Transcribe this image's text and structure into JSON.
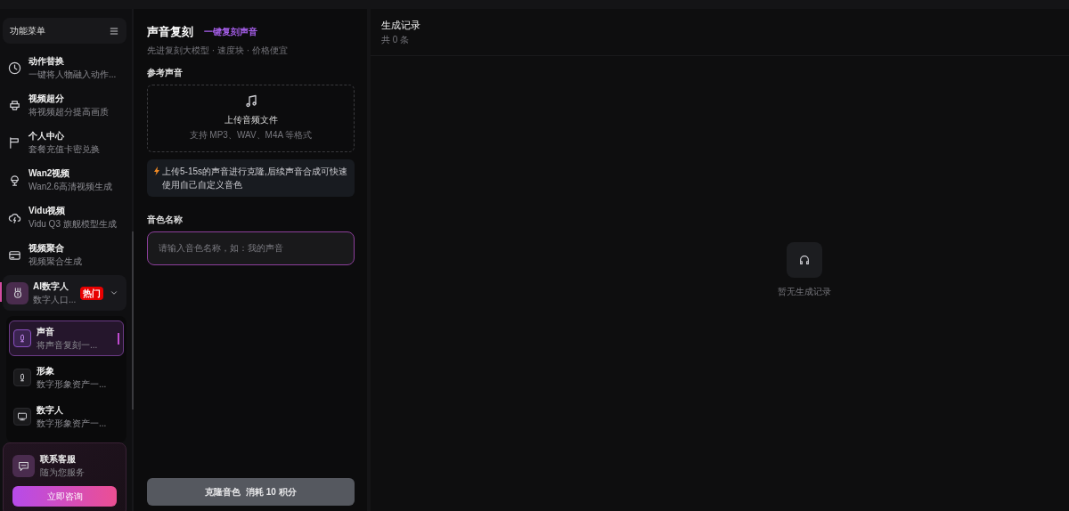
{
  "sidebar": {
    "title": "功能菜单",
    "items": [
      {
        "kind": "item",
        "label": "动作替换",
        "desc": "一键将人物融入动作..."
      },
      {
        "kind": "item",
        "label": "视频超分",
        "desc": "将视频超分提高画质"
      },
      {
        "kind": "item",
        "label": "个人中心",
        "desc": "套餐充值卡密兑换"
      },
      {
        "kind": "item",
        "label": "Wan2视频",
        "desc": "Wan2.6高清视频生成"
      },
      {
        "kind": "item",
        "label": "Vidu视频",
        "desc": "Vidu Q3 旗舰模型生成"
      },
      {
        "kind": "item",
        "label": "视频聚合",
        "desc": "视频聚合生成"
      },
      {
        "kind": "group",
        "label": "AI数字人",
        "desc": "数字人口...",
        "badge": "热门",
        "expanded": true,
        "children": [
          {
            "label": "声音",
            "desc": "将声音复刻一...",
            "selected": true
          },
          {
            "label": "形象",
            "desc": "数字形象资产一...",
            "selected": false
          },
          {
            "label": "数字人",
            "desc": "数字形象资产一...",
            "selected": false
          }
        ]
      }
    ],
    "contact": {
      "title": "联系客服",
      "subtitle": "随为您服务",
      "button": "立即咨询"
    }
  },
  "form": {
    "title": "声音复刻",
    "tag": "一键复刻声音",
    "subtitle": "先进复刻大模型 · 速度块 · 价格便宜",
    "reference_label": "参考声音",
    "upload_title": "上传音频文件",
    "upload_hint": "支持 MP3、WAV、M4A 等格式",
    "tip": "上传5-15s的声音进行克隆,后续声音合成可快速使用自己自定义音色",
    "name_label": "音色名称",
    "name_placeholder": "请输入音色名称，如：我的声音",
    "submit": "克隆音色  消耗 10 积分"
  },
  "records": {
    "title": "生成记录",
    "count": "共 0 条",
    "empty": "暂无生成记录"
  }
}
